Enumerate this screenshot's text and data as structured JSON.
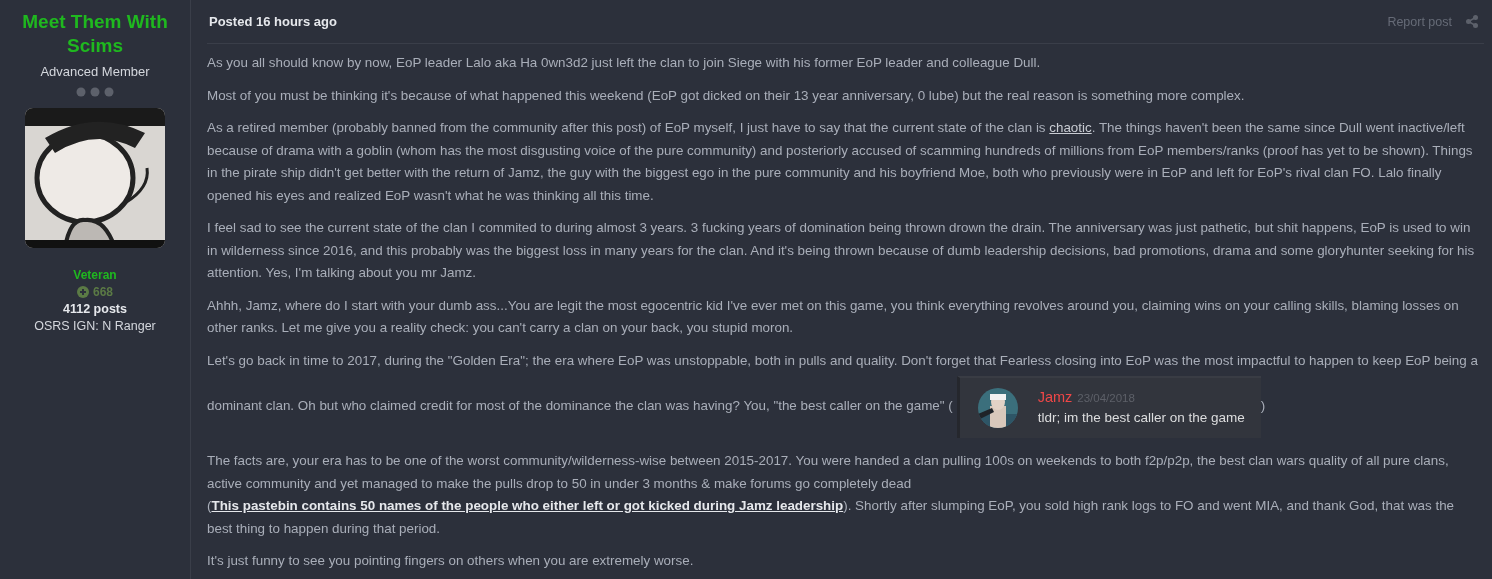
{
  "author": {
    "name": "Meet Them With Scims",
    "title": "Advanced Member",
    "group": "Veteran",
    "reputation": "668",
    "posts": "4112 posts",
    "custom_field": "OSRS IGN: N Ranger"
  },
  "post": {
    "posted": "Posted 16 hours ago",
    "report": "Report post",
    "paragraphs": [
      [
        {
          "kind": "text",
          "text": "As you all should know by now, EoP leader Lalo aka Ha 0wn3d2 just left the clan to join Siege with his former EoP leader and colleague Dull."
        }
      ],
      [
        {
          "kind": "text",
          "text": "Most of you must be thinking it's because of what happened this weekend (EoP got dicked on their 13 year anniversary, 0 lube) but the real reason is something more complex."
        }
      ],
      [
        {
          "kind": "text",
          "text": "As a retired member (probably banned from the community after this post) of EoP myself, I just have to say that the current state of the clan is "
        },
        {
          "kind": "link",
          "bold": false,
          "text": "chaotic"
        },
        {
          "kind": "text",
          "text": ". The things haven't been the same since Dull went inactive/left because of drama with a goblin (whom has the most disgusting voice of the pure community) and posteriorly accused of scamming hundreds of millions from EoP members/ranks (proof has yet to be shown). Things in the pirate ship didn't get better with the return of Jamz, the guy with the biggest ego in the pure community and his boyfriend Moe, both who previously were in EoP and left for EoP's rival clan FO. Lalo finally opened his eyes and realized EoP wasn't what he was thinking all this time."
        }
      ],
      [
        {
          "kind": "text",
          "text": "I feel sad to see the current state of the clan I commited to during almost 3 years. 3 fucking years of domination being thrown drown the drain. The anniversary was just pathetic, but shit happens, EoP is used to win in wilderness since 2016, and this probably was the biggest loss in many years for the clan. And it's being thrown because of dumb leadership decisions, bad promotions, drama and some gloryhunter seeking for his attention. Yes, I'm talking about you mr Jamz."
        }
      ],
      [
        {
          "kind": "text",
          "text": "Ahhh, Jamz, where do I start with your dumb ass...You are legit the most egocentric kid I've ever met on this game, you think everything revolves around you, claiming wins on your calling skills, blaming losses on other ranks. Let me give you a reality check: you can't carry a clan on your back, you stupid moron."
        }
      ],
      [
        {
          "kind": "text",
          "text": "Let's go back in time to 2017, during the \"Golden Era\"; the era where EoP was unstoppable, both in pulls and quality. Don't forget that Fearless closing into EoP was the most impactful to happen to keep EoP being a dominant clan. Oh but who claimed credit for most of the dominance the clan was having? You, \"the best caller on the game\" ("
        },
        {
          "kind": "embed",
          "author": "Jamz",
          "date": "23/04/2018",
          "message": "tldr; im the best caller on the game"
        },
        {
          "kind": "text",
          "text": ")"
        }
      ],
      [
        {
          "kind": "text",
          "text": "The facts are, your era has to be one of the worst community/wilderness-wise between 2015-2017. You were handed a clan pulling 100s on weekends to both f2p/p2p, the best clan wars quality of all pure clans, active community and yet managed to make the pulls drop to 50 in under 3 months & make forums go completely dead ("
        },
        {
          "kind": "link",
          "bold": true,
          "text": "This pastebin contains 50 names of the people who either left or got kicked during Jamz leadership"
        },
        {
          "kind": "text",
          "text": "). Shortly after slumping EoP, you sold high rank logs to FO and went MIA,  and thank God, that was the best thing to happen during that period."
        }
      ],
      [
        {
          "kind": "text",
          "text": "It's just funny to see you pointing fingers on others when you are extremely worse."
        }
      ]
    ]
  }
}
